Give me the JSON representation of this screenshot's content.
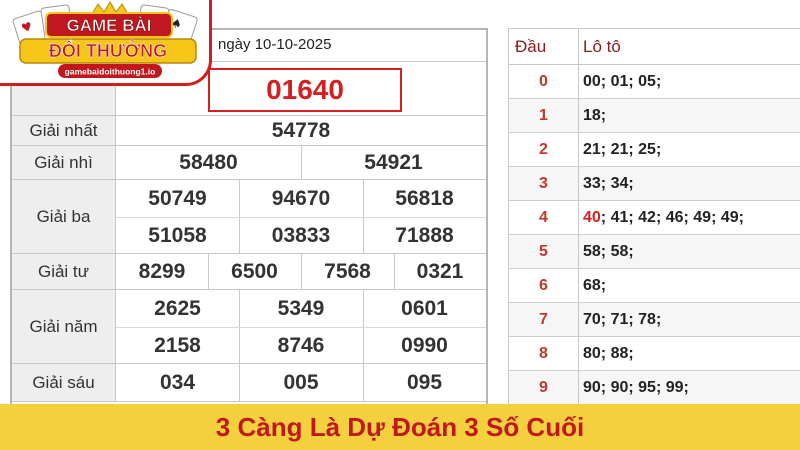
{
  "logo": {
    "line1": "GAME BÀI",
    "line2": "ĐỔI THƯỞNG",
    "url": "gamebaidoithuong1.io"
  },
  "results": {
    "date": "ngày 10-10-2025",
    "special": "01640",
    "rows": [
      {
        "label": "Giải nhất",
        "numbers": [
          "54778"
        ]
      },
      {
        "label": "Giải nhì",
        "numbers": [
          "58480",
          "54921"
        ]
      },
      {
        "label": "Giải ba",
        "numbers": [
          "50749",
          "94670",
          "56818",
          "51058",
          "03833",
          "71888"
        ]
      },
      {
        "label": "Giải tư",
        "numbers": [
          "8299",
          "6500",
          "7568",
          "0321"
        ]
      },
      {
        "label": "Giải năm",
        "numbers": [
          "2625",
          "5349",
          "0601",
          "2158",
          "8746",
          "0990"
        ]
      },
      {
        "label": "Giải sáu",
        "numbers": [
          "034",
          "005",
          "095"
        ]
      }
    ]
  },
  "loto": {
    "head_dau": "Đầu",
    "head_loto": "Lô tô",
    "rows": [
      {
        "dau": "0",
        "highlight": "",
        "rest": "00; 01; 05;"
      },
      {
        "dau": "1",
        "highlight": "",
        "rest": "18;"
      },
      {
        "dau": "2",
        "highlight": "",
        "rest": "21; 21; 25;"
      },
      {
        "dau": "3",
        "highlight": "",
        "rest": "33; 34;"
      },
      {
        "dau": "4",
        "highlight": "40",
        "rest": "; 41; 42; 46; 49; 49;"
      },
      {
        "dau": "5",
        "highlight": "",
        "rest": "58; 58;"
      },
      {
        "dau": "6",
        "highlight": "",
        "rest": "68;"
      },
      {
        "dau": "7",
        "highlight": "",
        "rest": "70; 71; 78;"
      },
      {
        "dau": "8",
        "highlight": "",
        "rest": "80; 88;"
      },
      {
        "dau": "9",
        "highlight": "",
        "rest": "90; 90; 95; 99;"
      }
    ]
  },
  "caption": "3 Càng Là Dự Đoán 3 Số Cuối",
  "colors": {
    "accent_red": "#d42020",
    "caption_bg": "#f4d03f",
    "caption_text": "#c0181e",
    "dau_text": "#c0392b"
  }
}
